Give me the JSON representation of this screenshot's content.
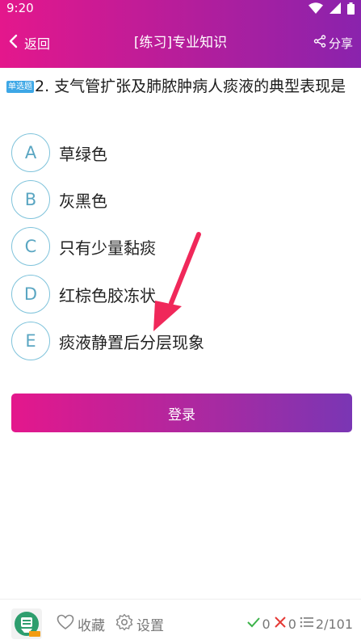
{
  "status_bar": {
    "time": "9:20",
    "icons": [
      "wifi-icon",
      "signal-icon",
      "battery-icon"
    ]
  },
  "nav": {
    "back_label": "返回",
    "title": "[练习]专业知识",
    "share_label": "分享"
  },
  "question": {
    "tag": "单选题",
    "text": "2. 支气管扩张及肺脓肿病人痰液的典型表现是"
  },
  "options": [
    {
      "letter": "A",
      "text": "草绿色"
    },
    {
      "letter": "B",
      "text": "灰黑色"
    },
    {
      "letter": "C",
      "text": "只有少量黏痰"
    },
    {
      "letter": "D",
      "text": "红棕色胶冻状"
    },
    {
      "letter": "E",
      "text": "痰液静置后分层现象"
    }
  ],
  "login_button": "登录",
  "bottom_bar": {
    "favorite_label": "收藏",
    "settings_label": "设置",
    "correct_count": "0",
    "wrong_count": "0",
    "progress": "2/101"
  },
  "colors": {
    "header_start": "#e4178c",
    "header_end": "#8a23ad",
    "tag": "#3da7e6",
    "option_circle": "#7fc3db",
    "correct": "#3cb34a",
    "wrong": "#e53935",
    "arrow": "#f0285a"
  }
}
